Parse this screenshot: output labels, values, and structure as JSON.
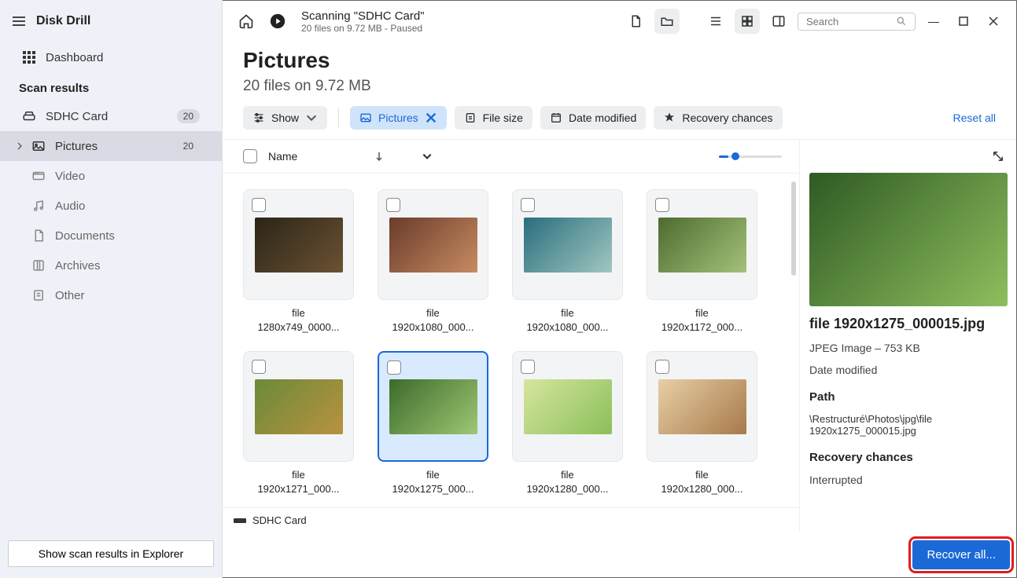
{
  "app": {
    "title": "Disk Drill"
  },
  "sidebar": {
    "dashboard": "Dashboard",
    "section": "Scan results",
    "items": [
      {
        "label": "SDHC Card",
        "badge": "20"
      },
      {
        "label": "Pictures",
        "badge": "20"
      },
      {
        "label": "Video"
      },
      {
        "label": "Audio"
      },
      {
        "label": "Documents"
      },
      {
        "label": "Archives"
      },
      {
        "label": "Other"
      }
    ],
    "footer_btn": "Show scan results in Explorer"
  },
  "header": {
    "status_title": "Scanning \"SDHC Card\"",
    "status_sub": "20 files on 9.72 MB - Paused",
    "search_placeholder": "Search"
  },
  "page": {
    "title": "Pictures",
    "subtitle": "20 files on 9.72 MB"
  },
  "filters": {
    "show": "Show",
    "pictures": "Pictures",
    "filesize": "File size",
    "date": "Date modified",
    "recovery": "Recovery chances",
    "reset": "Reset all"
  },
  "listhead": {
    "name": "Name"
  },
  "grid": {
    "items": [
      {
        "line1": "file",
        "line2": "1280x749_0000..."
      },
      {
        "line1": "file",
        "line2": "1920x1080_000..."
      },
      {
        "line1": "file",
        "line2": "1920x1080_000..."
      },
      {
        "line1": "file",
        "line2": "1920x1172_000..."
      },
      {
        "line1": "file",
        "line2": "1920x1271_000..."
      },
      {
        "line1": "file",
        "line2": "1920x1275_000..."
      },
      {
        "line1": "file",
        "line2": "1920x1280_000..."
      },
      {
        "line1": "file",
        "line2": "1920x1280_000..."
      }
    ]
  },
  "preview": {
    "filename": "file 1920x1275_000015.jpg",
    "type": "JPEG Image – 753 KB",
    "date_label": "Date modified",
    "path_label": "Path",
    "path": "\\Restructuré\\Photos\\jpg\\file 1920x1275_000015.jpg",
    "rc_label": "Recovery chances",
    "rc_value": "Interrupted"
  },
  "statusbar": {
    "device": "SDHC Card"
  },
  "actions": {
    "recover": "Recover all..."
  }
}
